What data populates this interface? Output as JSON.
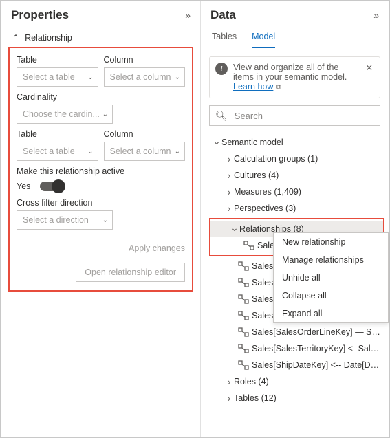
{
  "properties": {
    "title": "Properties",
    "section": "Relationship",
    "colors": {
      "highlight": "#e74c3c"
    },
    "fields": {
      "table1_label": "Table",
      "column1_label": "Column",
      "table2_label": "Table",
      "column2_label": "Column",
      "select_table_ph": "Select a table",
      "select_column_ph": "Select a column",
      "cardinality_label": "Cardinality",
      "cardinality_ph": "Choose the cardin...",
      "active_label": "Make this relationship active",
      "active_value": "Yes",
      "cross_filter_label": "Cross filter direction",
      "cross_filter_ph": "Select a direction"
    },
    "actions": {
      "apply": "Apply changes",
      "open_editor": "Open relationship editor"
    }
  },
  "data": {
    "title": "Data",
    "tabs": {
      "tables": "Tables",
      "model": "Model"
    },
    "info": {
      "text": "View and organize all of the items in your semantic model. ",
      "link": "Learn how"
    },
    "search_placeholder": "Search",
    "tree": {
      "root": "Semantic model",
      "groups": [
        {
          "label": "Calculation groups (1)"
        },
        {
          "label": "Cultures (4)"
        },
        {
          "label": "Measures (1,409)"
        },
        {
          "label": "Perspectives (3)"
        }
      ],
      "relationships": {
        "label": "Relationships (8)",
        "items": [
          "Sales[O",
          "Sales[D",
          "Sales[O",
          "Sales[P",
          "Sales[P",
          "Sales[SalesOrderLineKey] — Sales Or...",
          "Sales[SalesTerritoryKey] <- Sales Te...",
          "Sales[ShipDateKey] <-- Date[DateKey]"
        ]
      },
      "after": [
        {
          "label": "Roles (4)"
        },
        {
          "label": "Tables (12)"
        }
      ]
    },
    "context_menu": [
      "New relationship",
      "Manage relationships",
      "Unhide all",
      "Collapse all",
      "Expand all"
    ]
  }
}
